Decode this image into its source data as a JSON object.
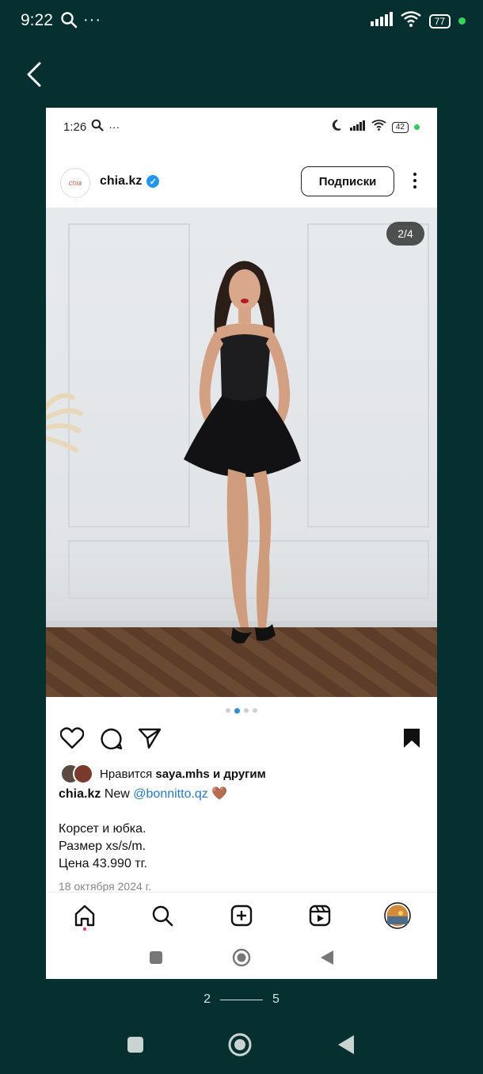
{
  "status_bar": {
    "time": "9:22",
    "battery": "77"
  },
  "inner_status_bar": {
    "time": "1:26",
    "battery": "42"
  },
  "post": {
    "username": "chia.kz",
    "avatar_text": "chia",
    "follow_label": "Подписки",
    "image_counter": "2/4",
    "likes": {
      "prefix": "Нравится",
      "user": "saya.mhs",
      "suffix": "и другим"
    },
    "caption": {
      "user": "chia.kz",
      "text_before": "New",
      "mention": "@bonnitto.qz",
      "emoji": "🤎",
      "lines": [
        "Корсет и юбка.",
        "Размер xs/s/m.",
        "Цена 43.990 тг."
      ]
    },
    "date": "18 октября 2024 г.",
    "carousel": {
      "count": 4,
      "active": 2
    }
  },
  "pager": {
    "current": "2",
    "total": "5"
  },
  "colors": {
    "background": "#06302f",
    "accent": "#2a8dd8",
    "mention": "#2a78c2"
  },
  "icons": [
    "search-icon",
    "more-icon",
    "signal-icon",
    "wifi-icon",
    "back-icon",
    "moon-icon",
    "verified-icon",
    "kebab-icon",
    "heart-icon",
    "comment-icon",
    "share-icon",
    "bookmark-icon",
    "home-icon",
    "add-icon",
    "reels-icon",
    "profile-icon",
    "square-icon",
    "circle-icon",
    "triangle-icon"
  ]
}
